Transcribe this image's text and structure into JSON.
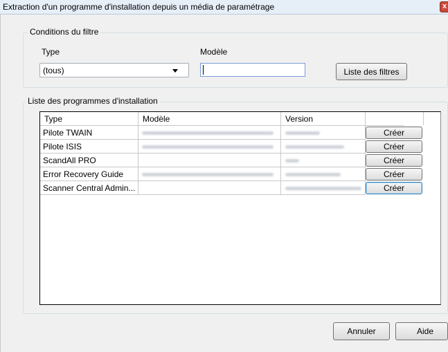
{
  "window": {
    "title": "Extraction d'un programme d'installation depuis un média de paramétrage",
    "close_label": "x"
  },
  "filter_group": {
    "legend": "Conditions du filtre",
    "type_label": "Type",
    "type_value": "(tous)",
    "model_label": "Modèle",
    "model_value": "",
    "filter_list_button": "Liste des filtres"
  },
  "programs_group": {
    "legend": "Liste des programmes d'installation",
    "columns": [
      "Type",
      "Modèle",
      "Version",
      ""
    ],
    "rows": [
      {
        "type": "Pilote TWAIN",
        "model": "",
        "version": "",
        "action": "Créer"
      },
      {
        "type": "Pilote ISIS",
        "model": "",
        "version": "",
        "action": "Créer"
      },
      {
        "type": "ScandAll PRO",
        "model": "",
        "version": "",
        "action": "Créer"
      },
      {
        "type": "Error Recovery Guide",
        "model": "",
        "version": "",
        "action": "Créer"
      },
      {
        "type": "Scanner Central Admin...",
        "model": "",
        "version": "",
        "action": "Créer"
      }
    ]
  },
  "footer": {
    "cancel_button": "Annuler",
    "help_button": "Aide"
  },
  "colors": {
    "window_bg": "#f0f0f0",
    "titlebar_bg": "#e6eef8",
    "close_red": "#c9483c",
    "focus_blue": "#3c7fb1"
  }
}
